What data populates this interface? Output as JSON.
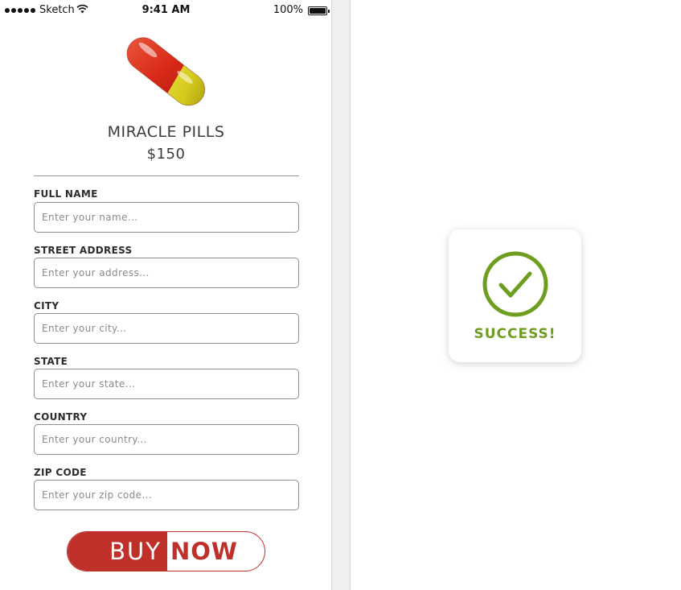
{
  "status_bar": {
    "carrier": "Sketch",
    "time": "9:41 AM",
    "battery": "100%"
  },
  "product": {
    "name": "MIRACLE PILLS",
    "price": "$150",
    "image_icon": "pill-capsule-icon"
  },
  "form": {
    "fields": [
      {
        "label": "FULL NAME",
        "placeholder": "Enter your name...",
        "value": ""
      },
      {
        "label": "STREET ADDRESS",
        "placeholder": "Enter your address...",
        "value": ""
      },
      {
        "label": "CITY",
        "placeholder": "Enter your city...",
        "value": ""
      },
      {
        "label": "STATE",
        "placeholder": "Enter your state...",
        "value": ""
      },
      {
        "label": "COUNTRY",
        "placeholder": "Enter your country...",
        "value": ""
      },
      {
        "label": "ZIP CODE",
        "placeholder": "Enter your zip code...",
        "value": ""
      }
    ]
  },
  "buy_button": {
    "part1": "BUY",
    "part2": "NOW"
  },
  "success": {
    "message": "SUCCESS!",
    "icon": "check-circle-icon"
  },
  "colors": {
    "accent_red": "#c0302b",
    "success_green": "#6e9e1f",
    "text_dark": "#3b3b3b"
  }
}
